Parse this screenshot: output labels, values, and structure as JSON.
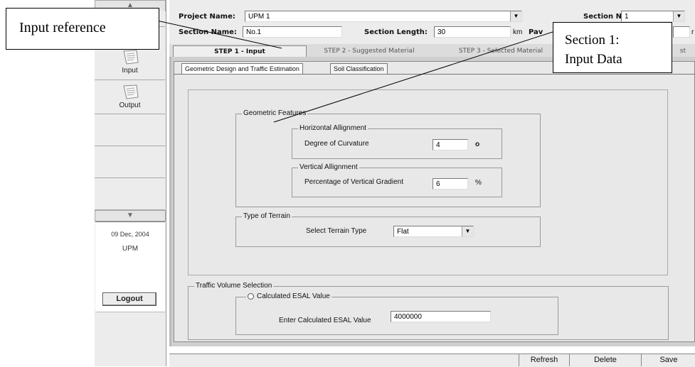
{
  "header": {
    "project_name_label": "Project Name:",
    "project_name_value": "UPM 1",
    "section_no_label": "Section No:",
    "section_no_value": "1",
    "section_name_label": "Section Name:",
    "section_name_value": "No.1",
    "section_length_label": "Section Length:",
    "section_length_value": "30",
    "section_length_unit": "km",
    "pav_label": "Pav",
    "right_unit": "r"
  },
  "steps": [
    "STEP 1 - Input",
    "STEP 2 - Suggested Material",
    "STEP 3 - Selected Material",
    "st"
  ],
  "subtabs": [
    "Geometric Design and Traffic Estimation",
    "Soil Classification"
  ],
  "sidebar": {
    "input_label": "Input",
    "output_label": "Output",
    "date": "09 Dec, 2004",
    "user": "UPM",
    "logout_label": "Logout"
  },
  "form": {
    "geometric_title": "Geometric Features",
    "horizontal_title": "Horizontal Allignment",
    "degree_label": "Degree of Curvature",
    "degree_value": "4",
    "degree_unit": "o",
    "vertical_title": "Vertical Allignment",
    "gradient_label": "Percentage of Vertical Gradient",
    "gradient_value": "6",
    "gradient_unit": "%",
    "terrain_title": "Type of Terrain",
    "terrain_label": "Select Terrain Type",
    "terrain_value": "Flat",
    "traffic_title": "Traffic Volume Selection",
    "esal_radio_label": "Calculated ESAL Value",
    "esal_input_label": "Enter Calculated ESAL Value",
    "esal_value": "4000000"
  },
  "buttons": {
    "refresh": "Refresh",
    "delete": "Delete",
    "save": "Save"
  },
  "callouts": {
    "left": "Input reference",
    "right_line1": "Section 1:",
    "right_line2": "Input Data"
  }
}
